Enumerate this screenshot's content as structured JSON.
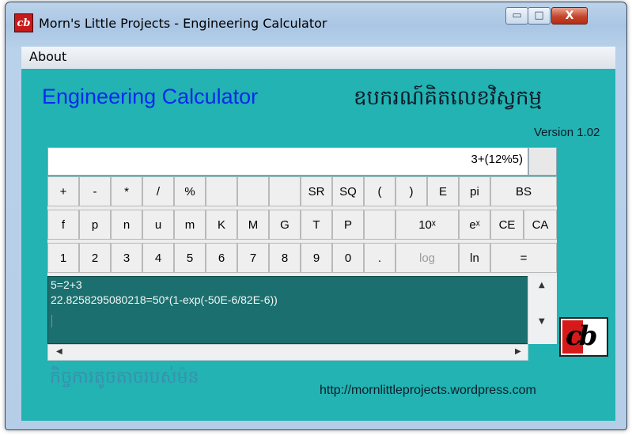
{
  "window": {
    "title": "Morn's Little Projects - Engineering Calculator",
    "icon": "cb-logo-icon"
  },
  "controls": {
    "minimize": "▭",
    "maximize": "□",
    "close": "X"
  },
  "menu": {
    "items": [
      {
        "label": "About"
      }
    ]
  },
  "header": {
    "title": "Engineering Calculator",
    "khmer_title": "ឧបករណ៍គិតលេខវិស្វកម្ម",
    "version": "Version 1.02"
  },
  "display": {
    "value": "3+(12%5)"
  },
  "keypad": {
    "rows": [
      [
        "+",
        "-",
        "*",
        "/",
        "%",
        "",
        "",
        "",
        "SR",
        "SQ",
        "(",
        ")",
        "E",
        "pi",
        "BS"
      ],
      [
        "f",
        "p",
        "n",
        "u",
        "m",
        "K",
        "M",
        "G",
        "T",
        "P",
        "",
        "10ˣ",
        "eˣ",
        "CE",
        "CA"
      ],
      [
        "1",
        "2",
        "3",
        "4",
        "5",
        "6",
        "7",
        "8",
        "9",
        "0",
        ".",
        "log",
        "ln",
        "="
      ]
    ]
  },
  "history": {
    "lines": [
      "5=2+3",
      "22.8258295080218=50*(1-exp(-50E-6/82E-6))"
    ]
  },
  "footer": {
    "khmer_text": "កិច្ចការតូចតាចរបស់ម៉ន",
    "url": "http://mornlittleprojects.wordpress.com"
  },
  "logo": {
    "text": "cb"
  },
  "colors": {
    "background": "#22b3b2",
    "title": "#0b28f0",
    "history_bg": "#1b6f6e"
  }
}
